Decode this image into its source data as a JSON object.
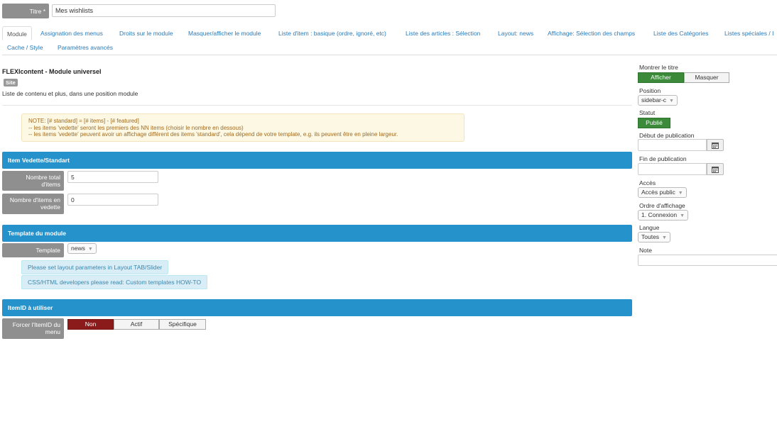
{
  "title_field": {
    "label": "Titre",
    "required_mark": "*",
    "value": "Mes wishlists"
  },
  "tabs": [
    {
      "label": "Module",
      "active": true
    },
    {
      "label": "Assignation des menus"
    },
    {
      "label": "Droits sur le module"
    },
    {
      "label": "Masquer/afficher le module"
    },
    {
      "label": "Liste d'item : basique (ordre, ignoré, etc)"
    },
    {
      "label": "Liste des articles : Sélection"
    },
    {
      "label": "Layout: news"
    },
    {
      "label": "Affichage: Sélection des champs"
    },
    {
      "label": "Liste des Catégories"
    },
    {
      "label": "Listes spéciales / I"
    },
    {
      "label": "Cache / Style"
    },
    {
      "label": "Paramètres avancés"
    }
  ],
  "module": {
    "title": "FLEXIcontent - Module universel",
    "badge": "Site",
    "description": "Liste de contenu et plus, dans une position module"
  },
  "note": {
    "line1": "NOTE: [# standard] = [# items] - [# featured]",
    "line2": "-- les items 'vedette' seront les premiers des NN items (choisir le nombre en dessous)",
    "line3": "-- les items 'vedette' peuvent avoir un affichage différent des items 'standard', cela dépend de votre template, e.g. ils peuvent être en pleine largeur."
  },
  "sections": {
    "featured": {
      "header": "Item Vedette/Standart",
      "total_label": "Nombre total d'items",
      "total_value": "5",
      "featured_label": "Nombre d'items en vedette",
      "featured_value": "0"
    },
    "template": {
      "header": "Template du module",
      "template_label": "Template",
      "template_value": "news",
      "info1": "Please set layout parameters in Layout TAB/Slider",
      "info2": "CSS/HTML developers please read: Custom templates HOW-TO"
    },
    "itemid": {
      "header": "ItemID à utiliser",
      "force_label": "Forcer l'ItemID du menu",
      "options": [
        "Non",
        "Actif",
        "Spécifique"
      ],
      "selected": "Non"
    }
  },
  "sidebar": {
    "show_title_label": "Montrer le titre",
    "show_title_options": [
      "Afficher",
      "Masquer"
    ],
    "show_title_selected": "Afficher",
    "position_label": "Position",
    "position_value": "sidebar-c",
    "status_label": "Statut",
    "status_value": "Publié",
    "start_label": "Début de publication",
    "end_label": "Fin de publication",
    "access_label": "Accès",
    "access_value": "Accès public",
    "order_label": "Ordre d'affichage",
    "order_value": "1. Connexion",
    "language_label": "Langue",
    "language_value": "Toutes",
    "note_label": "Note"
  },
  "colors": {
    "section_blue": "#2592cb",
    "active_red": "#8b1a1a",
    "active_green": "#3a8a3a",
    "link_blue": "#2a7ab8",
    "label_grey": "#8f8f8f"
  },
  "icons": {
    "calendar": "calendar-icon",
    "caret": "caret-down-icon"
  }
}
